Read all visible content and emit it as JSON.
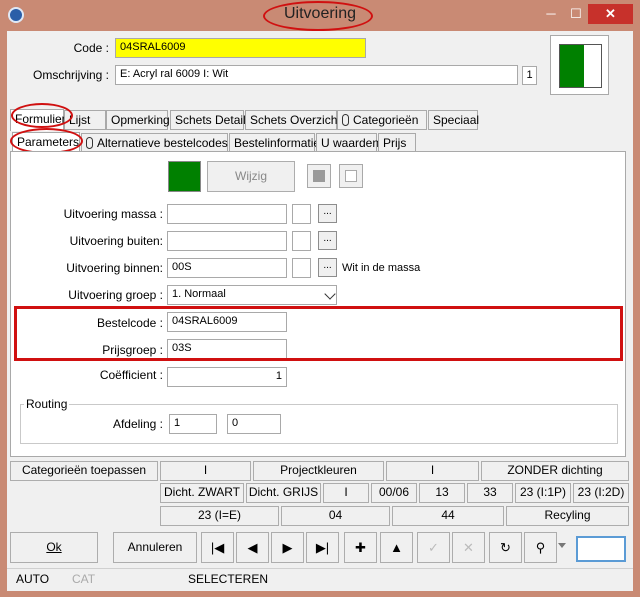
{
  "window": {
    "title": "Uitvoering"
  },
  "header": {
    "code_label": "Code :",
    "code_value": "04SRAL6009",
    "omschrijving_label": "Omschrijving :",
    "omschrijving_value": "E: Acryl ral 6009 I: Wit",
    "count_value": "1",
    "swatch_color": "#008000"
  },
  "tabs": [
    {
      "label": "Formulier"
    },
    {
      "label": "Lijst"
    },
    {
      "label": "Opmerking"
    },
    {
      "label": "Schets Detail"
    },
    {
      "label": "Schets Overzicht"
    },
    {
      "label": "Categorieën"
    },
    {
      "label": "Speciaal"
    }
  ],
  "subtabs": [
    {
      "label": "Parameters"
    },
    {
      "label": "Alternatieve bestelcodes"
    },
    {
      "label": "Bestelinformatie"
    },
    {
      "label": "U waarden"
    },
    {
      "label": "Prijs"
    }
  ],
  "form": {
    "wijzig_label": "Wijzig",
    "massa_label": "Uitvoering massa :",
    "massa_value": "",
    "buiten_label": "Uitvoering buiten:",
    "buiten_value": "",
    "binnen_label": "Uitvoering binnen:",
    "binnen_value": "00S",
    "binnen_note": "Wit in de massa",
    "groep_label": "Uitvoering groep :",
    "groep_value": "1.  Normaal",
    "bestelcode_label": "Bestelcode :",
    "bestelcode_value": "04SRAL6009",
    "prijsgroep_label": "Prijsgroep :",
    "prijsgroep_value": "03S",
    "coefficient_label": "Coëfficient :",
    "coefficient_value": "1",
    "routing_label": "Routing",
    "afdeling_label": "Afdeling :",
    "afdeling_value1": "1",
    "afdeling_value2": "0",
    "ellipsis": "..."
  },
  "categories": {
    "apply_label": "Categorieën toepassen",
    "row1": [
      "I",
      "Projectkleuren",
      "I",
      "ZONDER dichting"
    ],
    "row2": [
      "Dicht. ZWART",
      "Dicht. GRIJS",
      "I",
      "00/06",
      "13",
      "33",
      "23 (I:1P)",
      "23 (I:2D)"
    ],
    "row3": [
      "23 (I=E)",
      "04",
      "44",
      "Recyling"
    ]
  },
  "actions": {
    "ok_label": "Ok",
    "cancel_label": "Annuleren",
    "nav_icons": [
      "first-icon",
      "prev-icon",
      "next-icon",
      "last-icon",
      "add-icon",
      "up-icon",
      "confirm-icon",
      "cancel-icon",
      "refresh-icon",
      "find-icon"
    ],
    "nav_glyphs": [
      "|◀",
      "◀",
      "▶",
      "▶|",
      "✚",
      "▲",
      "✓",
      "✕",
      "↻",
      "⚲"
    ]
  },
  "status": {
    "mode1": "AUTO",
    "mode2": "CAT",
    "mode3": "SELECTEREN"
  }
}
